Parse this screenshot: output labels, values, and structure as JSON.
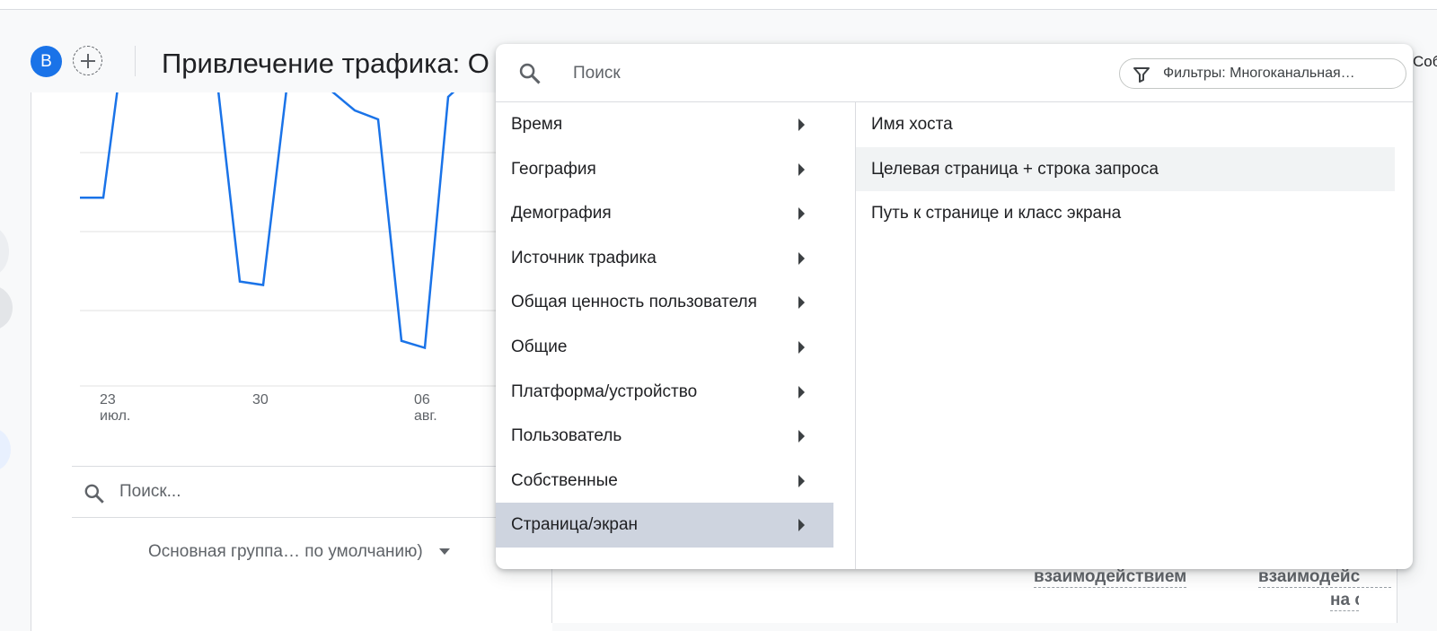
{
  "header": {
    "avatar_letter": "B",
    "page_title": "Привлечение трафика: О",
    "right_fragment": "Соб"
  },
  "chart": {
    "x_ticks": [
      {
        "day": "23",
        "month": "июл."
      },
      {
        "day": "30",
        "month": ""
      },
      {
        "day": "06",
        "month": "авг."
      }
    ]
  },
  "chart_data": {
    "type": "line",
    "x": [
      "23 июл.",
      "",
      "",
      "",
      "",
      "",
      "",
      "30",
      "",
      "",
      "",
      "",
      "",
      "",
      "06 авг.",
      ""
    ],
    "series": [
      {
        "values": [
          null,
          null,
          0.57,
          0.57,
          null,
          null,
          null,
          0.33,
          0.32,
          null,
          null,
          null,
          null,
          null,
          0.16,
          0.14
        ]
      }
    ],
    "grid": true,
    "colors": {
      "line": "#1a73e8"
    }
  },
  "table_search": {
    "placeholder": "Поиск..."
  },
  "group_select": {
    "value": "Основная группа… по умолчанию)"
  },
  "table_headers": [
    {
      "text": "взаимодействием"
    },
    {
      "text": "взаимодейс"
    },
    {
      "text": "на с"
    }
  ],
  "popup": {
    "search_placeholder": "Поиск",
    "filter_chip": "Фильтры: Многоканальная…",
    "categories": [
      {
        "label": "Время"
      },
      {
        "label": "География"
      },
      {
        "label": "Демография"
      },
      {
        "label": "Источник трафика"
      },
      {
        "label": "Общая ценность пользователя"
      },
      {
        "label": "Общие"
      },
      {
        "label": "Платформа/устройство"
      },
      {
        "label": "Пользователь"
      },
      {
        "label": "Собственные"
      },
      {
        "label": "Страница/экран"
      }
    ],
    "active_category": "Страница/экран",
    "sub_items": [
      {
        "label": "Имя хоста"
      },
      {
        "label": "Целевая страница + строка запроса"
      },
      {
        "label": "Путь к странице и класс экрана"
      }
    ],
    "hovered_sub_item": "Целевая страница + строка запроса"
  },
  "colors": {
    "accent": "#1a73e8",
    "active_row": "#ced4df",
    "hover_row": "#f1f3f4"
  }
}
